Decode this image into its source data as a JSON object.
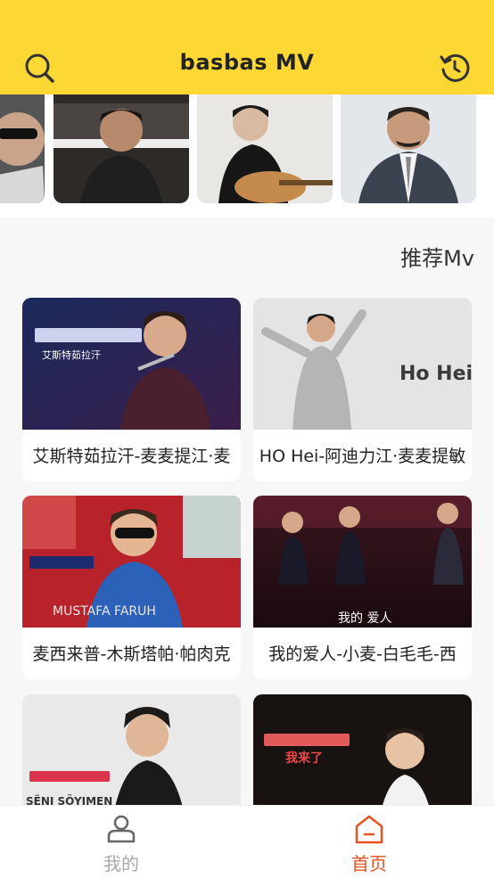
{
  "header": {
    "title": "basbas  MV",
    "search_icon": "search-icon",
    "history_icon": "history-icon"
  },
  "section": {
    "title": "推荐Mv"
  },
  "videos": [
    {
      "caption": "艾斯特茹拉汗-麦麦提江·麦",
      "overlay": "艾斯特茹拉汗"
    },
    {
      "caption": "HO Hei-阿迪力江·麦麦提敏",
      "overlay": "Ho Hei"
    },
    {
      "caption": "麦西来普-木斯塔帕·帕肉克",
      "overlay": "MUSTAFA FARUH"
    },
    {
      "caption": "我的爱人-小麦-白毛毛-西",
      "overlay": "我的 爱人"
    },
    {
      "caption": "",
      "overlay": "SËNI SÖYIMEN"
    },
    {
      "caption": "",
      "overlay": "我来了"
    }
  ],
  "tabs": [
    {
      "label": "我的",
      "icon": "user-icon",
      "active": false
    },
    {
      "label": "首页",
      "icon": "home-icon",
      "active": true
    }
  ]
}
